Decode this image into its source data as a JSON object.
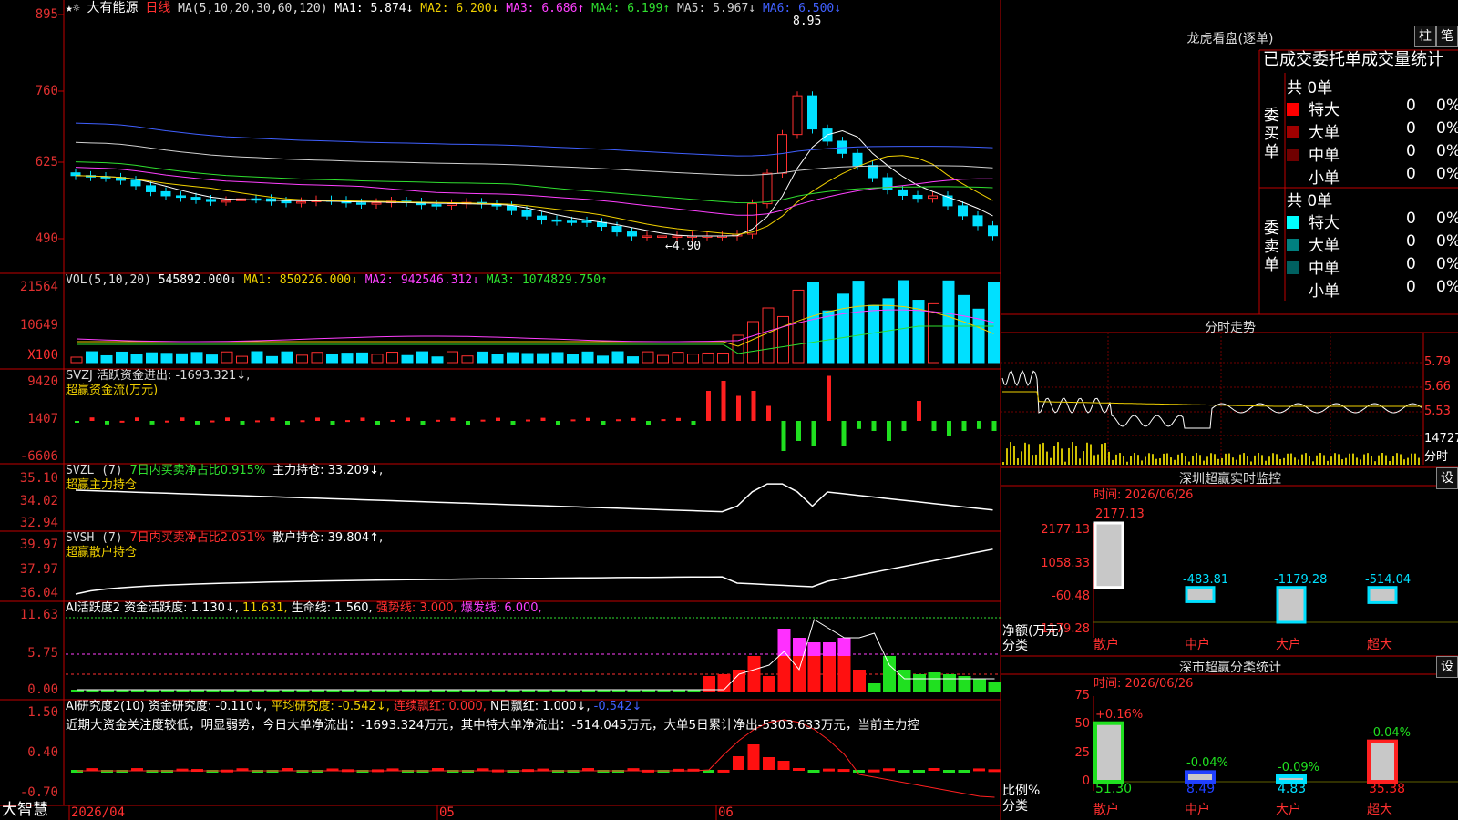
{
  "app": {
    "logo": "大智慧"
  },
  "stock": {
    "name": "大有能源",
    "period": "日线"
  },
  "ma": {
    "label": "MA(5,10,20,30,60,120)",
    "items": [
      {
        "t": "MA1: 5.874↓",
        "c": "#ffffff"
      },
      {
        "t": "MA2: 6.200↓",
        "c": "#f0d000"
      },
      {
        "t": "MA3: 6.686↑",
        "c": "#ff40ff"
      },
      {
        "t": "MA4: 6.199↑",
        "c": "#30e030"
      },
      {
        "t": "MA5: 5.967↓",
        "c": "#d0d0d0"
      },
      {
        "t": "MA6: 6.500↓",
        "c": "#4060ff"
      }
    ]
  },
  "price_axis": [
    "895",
    "760",
    "625",
    "490"
  ],
  "price_annot": {
    "high": "8.95",
    "low": "←4.90"
  },
  "vol": {
    "label": "VOL(5,10,20)",
    "items": [
      {
        "t": "545892.000↓",
        "c": "#fff"
      },
      {
        "t": "MA1: 850226.000↓",
        "c": "#f0d000"
      },
      {
        "t": "MA2: 942546.312↓",
        "c": "#ff40ff"
      },
      {
        "t": "MA3: 1074829.750↑",
        "c": "#30e030"
      }
    ],
    "axis": [
      "21564",
      "10649"
    ],
    "unit": "X100"
  },
  "svzj": {
    "label": "SVZJ  活跃资金进出: -1693.321↓,",
    "sub": "超赢资金流(万元)",
    "axis": [
      "9420",
      "1407",
      "-6606"
    ]
  },
  "svzl": {
    "label": "SVZL (7)",
    "label2": "7日内买卖净占比0.915%",
    "label3": "主力持仓: 33.209↓,",
    "sub": "超赢主力持仓",
    "axis": [
      "35.10",
      "34.02",
      "32.94"
    ]
  },
  "svsh": {
    "label": "SVSH (7)",
    "label2": "7日内买卖净占比2.051%",
    "label3": "散户持仓: 39.804↑,",
    "sub": "超赢散户持仓",
    "axis": [
      "39.97",
      "37.97",
      "36.04"
    ]
  },
  "ai1": {
    "label": "AI活跃度2 资金活跃度: 1.130↓,",
    "v2": "11.631,",
    "v3": "生命线: 1.560,",
    "v4": "强势线: 3.000,",
    "v5": "爆发线: 6.000,",
    "axis": [
      "11.63",
      "5.75",
      "0.00"
    ]
  },
  "ai2": {
    "label": "AI研究度2(10) 资金研究度: -0.110↓,",
    "v2": "平均研究度: -0.542↓,",
    "v3": "连续飘红: 0.000,",
    "v4": "N日飘红: 1.000↓,",
    "v5": "-0.542↓",
    "text": "近期大资金关注度较低，明显弱势，今日大单净流出：-1693.324万元，其中特大单净流出：-514.045万元，大单5日累计净出-5303.633万元，当前主力控",
    "axis": [
      "1.50",
      "0.40",
      "-0.70"
    ]
  },
  "xaxis": [
    "2026/04",
    "05",
    "06"
  ],
  "lhb": {
    "title": "龙虎看盘(逐单)",
    "btn1": "柱",
    "btn2": "笔",
    "tabs": "已成交委托单成交量统计",
    "buy": {
      "side": "委买单",
      "total": "共 0单",
      "rows": [
        {
          "n": "特大",
          "v": "0",
          "p": "0%",
          "c": "#ff0000"
        },
        {
          "n": "大单",
          "v": "0",
          "p": "0%",
          "c": "#a00000"
        },
        {
          "n": "中单",
          "v": "0",
          "p": "0%",
          "c": "#700000"
        },
        {
          "n": "小单",
          "v": "0",
          "p": "0%",
          "c": "#000000"
        }
      ]
    },
    "sell": {
      "side": "委卖单",
      "total": "共 0单",
      "rows": [
        {
          "n": "特大",
          "v": "0",
          "p": "0%",
          "c": "#00ffff"
        },
        {
          "n": "大单",
          "v": "0",
          "p": "0%",
          "c": "#008080"
        },
        {
          "n": "中单",
          "v": "0",
          "p": "0%",
          "c": "#006060"
        },
        {
          "n": "小单",
          "v": "0",
          "p": "0%",
          "c": "#000000"
        }
      ]
    }
  },
  "intraday": {
    "title": "分时走势",
    "axis": [
      "5.79",
      "5.66",
      "5.53"
    ],
    "vol": "14727",
    "unit": "分时"
  },
  "monitor": {
    "title": "深圳超赢实时监控",
    "btn": "设",
    "time": "时间: 2026/06/26",
    "axis": [
      "2177.13",
      "1058.33",
      "-60.48",
      "-1179.28"
    ],
    "ylabel": "净额(万元)",
    "xlabel": "分类",
    "cats": [
      "散户",
      "中户",
      "大户",
      "超大"
    ],
    "values": [
      {
        "t": "2177.13",
        "v": 2177.13
      },
      {
        "t": "-483.81",
        "v": -483.81
      },
      {
        "t": "-1179.28",
        "v": -1179.28
      },
      {
        "t": "-514.04",
        "v": -514.04
      }
    ]
  },
  "classify": {
    "title": "深市超赢分类统计",
    "btn": "设",
    "time": "时间: 2026/06/26",
    "axis": [
      "75",
      "50",
      "25",
      "0"
    ],
    "ylabel": "比例%",
    "xlabel": "分类",
    "cats": [
      "散户",
      "中户",
      "大户",
      "超大"
    ],
    "values": [
      {
        "v": 51.3,
        "t": "51.30",
        "d": "+0.16%"
      },
      {
        "v": 8.49,
        "t": "8.49",
        "d": "-0.04%"
      },
      {
        "v": 4.83,
        "t": "4.83",
        "d": "-0.09%"
      },
      {
        "v": 35.38,
        "t": "35.38",
        "d": "-0.04%"
      }
    ]
  }
}
